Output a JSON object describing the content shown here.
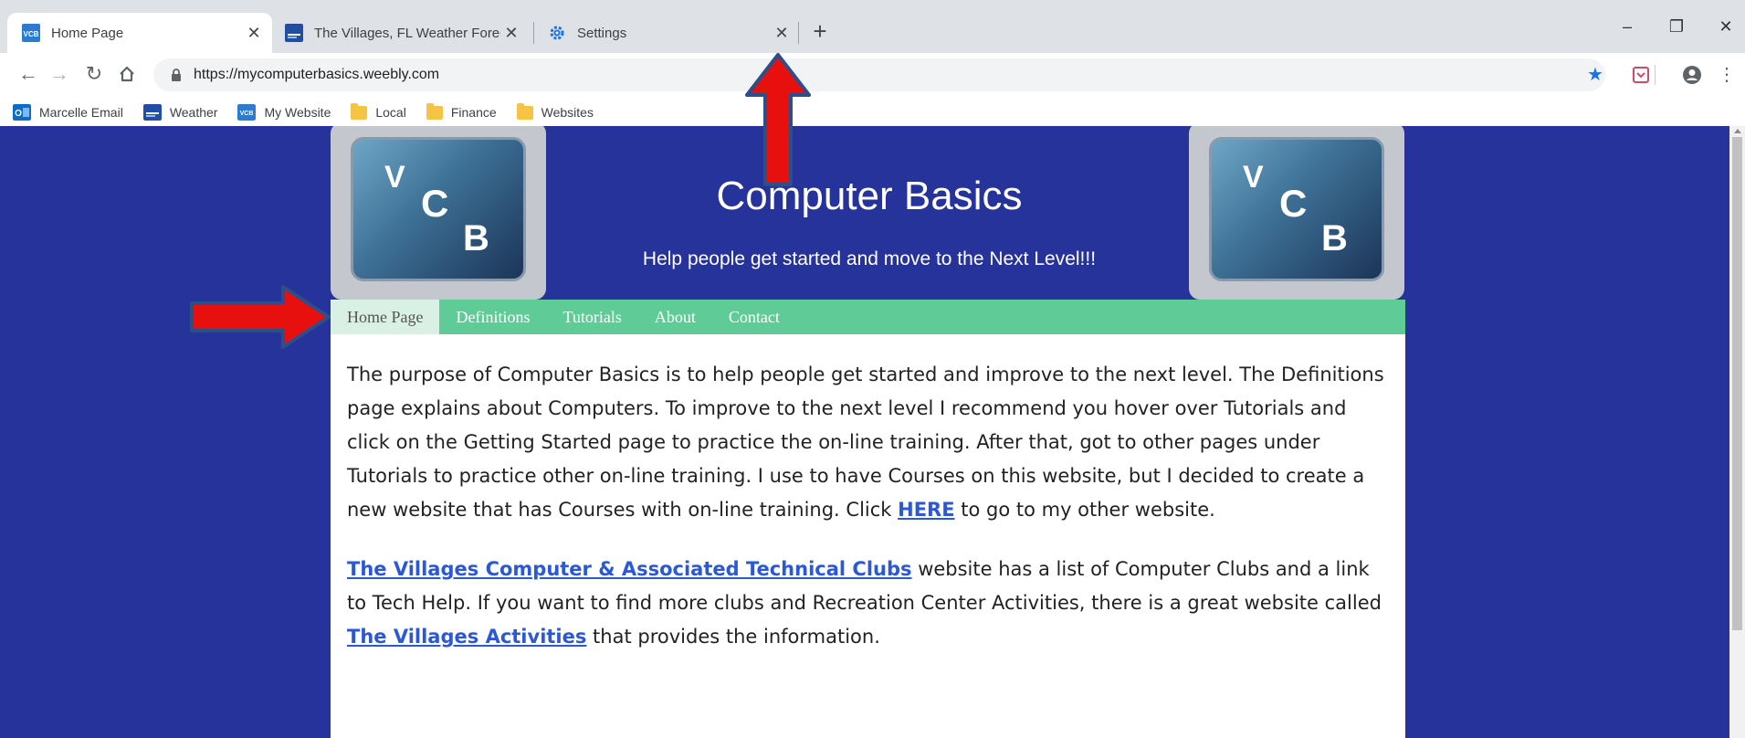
{
  "tabs": [
    {
      "title": "Home Page",
      "favicon": "vcb-icon",
      "active": true
    },
    {
      "title": "The Villages, FL Weather Forecast",
      "favicon": "weather-icon",
      "active": false
    },
    {
      "title": "Settings",
      "favicon": "settings-gear-icon",
      "active": false
    }
  ],
  "new_tab_label": "+",
  "toolbar": {
    "url": "https://mycomputerbasics.weebly.com"
  },
  "bookmarks": [
    {
      "label": "Marcelle Email",
      "icon": "outlook-icon"
    },
    {
      "label": "Weather",
      "icon": "weather-icon"
    },
    {
      "label": "My Website",
      "icon": "vcb-icon"
    },
    {
      "label": "Local",
      "icon": "folder-icon"
    },
    {
      "label": "Finance",
      "icon": "folder-icon"
    },
    {
      "label": "Websites",
      "icon": "folder-icon"
    }
  ],
  "site": {
    "logo_letters": [
      "V",
      "C",
      "B"
    ],
    "title": "Computer Basics",
    "tagline": "Help people get started and move to the Next Level!!!",
    "nav": [
      "Home Page",
      "Definitions",
      "Tutorials",
      "About",
      "Contact"
    ],
    "paragraph1": {
      "text_before": "The purpose of Computer Basics is to help people get started and improve to the next level.  The Definitions page explains about Computers.  To improve to the next level I recommend you hover over Tutorials and click on the Getting Started page to practice the on-line training.  After that, got to other pages under Tutorials to practice other on-line training.  I use to have Courses on this website, but I decided to create a new website that has Courses with on-line training.  Click ",
      "link": "HERE",
      "text_after": " to go to my other website."
    },
    "paragraph2": {
      "link1": "The Villages Computer & Associated Technical Clubs",
      "text_middle": " website has a list of Computer Clubs and a link to Tech Help.  If you want to find more clubs and Recreation Center Activities, there is a great website called ",
      "link2": "The Villages Activities",
      "text_after": " that provides the information."
    }
  },
  "colors": {
    "page_background": "#26339a",
    "nav_background": "#5fcc98",
    "nav_active": "#d9f1e4",
    "link": "#2a58d6",
    "annotation_arrow": "#e8100f"
  }
}
